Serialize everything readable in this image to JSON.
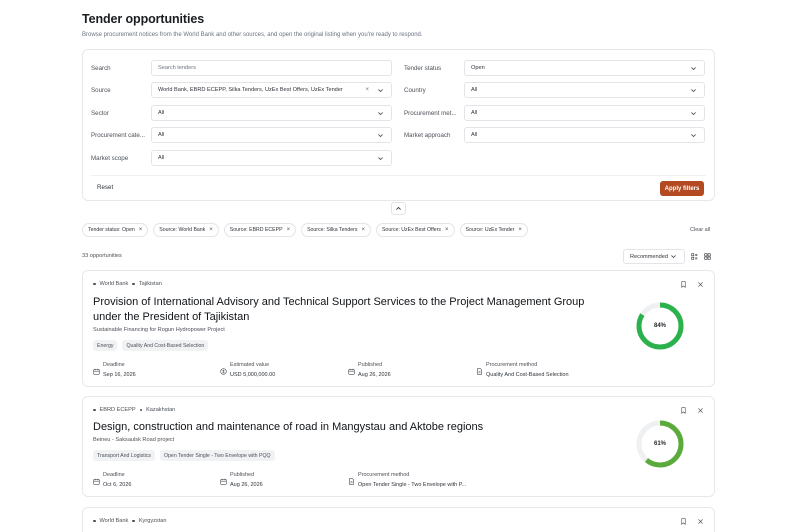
{
  "header": {
    "title": "Tender opportunities",
    "subtitle": "Browse procurement notices from the World Bank and other sources, and open the original listing when you're ready to respond."
  },
  "filters": {
    "search": {
      "label": "Search",
      "placeholder": "Search tenders"
    },
    "source": {
      "label": "Source",
      "value": "World Bank, EBRD ECEPP, Silka Tenders, UzEx Best Offers, UzEx Tender"
    },
    "sector": {
      "label": "Sector",
      "value": "All"
    },
    "procurement_category": {
      "label": "Procurement cate...",
      "value": "All"
    },
    "market_scope": {
      "label": "Market scope",
      "value": "All"
    },
    "tender_status": {
      "label": "Tender status",
      "value": "Open"
    },
    "country": {
      "label": "Country",
      "value": "All"
    },
    "procurement_method": {
      "label": "Procurement met...",
      "value": "All"
    },
    "market_approach": {
      "label": "Market approach",
      "value": "All"
    },
    "reset_label": "Reset",
    "apply_label": "Apply filters"
  },
  "chips": [
    "Tender status: Open",
    "Source: World Bank",
    "Source: EBRD ECEPP",
    "Source: Silka Tenders",
    "Source: UzEx Best Offers",
    "Source: UzEx Tender"
  ],
  "clear_all_label": "Clear all",
  "results_count": "33 opportunities",
  "sort": {
    "value": "Recommended"
  },
  "colors": {
    "accent": "#b34a22",
    "score_green": "#2bb24c",
    "score_olive": "#5aab3c",
    "track": "#eef0f2"
  },
  "cards": [
    {
      "source": "World Bank",
      "country": "Tajikistan",
      "title": "Provision of International Advisory and Technical Support Services to the Project Management Group under the President of Tajikistan",
      "subtitle": "Sustainable Financing for Rogun Hydropower Project",
      "tags": [
        "Energy",
        "Quality And Cost-Based Selection"
      ],
      "facts": [
        {
          "label": "Deadline",
          "value": "Sep 16, 2026",
          "icon": "calendar-icon"
        },
        {
          "label": "Estimated value",
          "value": "USD 5,000,000.00",
          "icon": "dollar-icon"
        },
        {
          "label": "Published",
          "value": "Aug 26, 2026",
          "icon": "calendar-icon"
        },
        {
          "label": "Procurement method",
          "value": "Quality And Cost-Based Selection",
          "icon": "document-icon"
        }
      ],
      "score": 0.84,
      "score_label": "84%"
    },
    {
      "source": "EBRD ECEPP",
      "country": "Kazakhstan",
      "title": "Design, construction and maintenance of road in Mangystau and Aktobe regions",
      "subtitle": "Beineu - Saksaulsk Road project",
      "tags": [
        "Transport And Logistics",
        "Open Tender Single - Two Envelope with PQQ"
      ],
      "facts": [
        {
          "label": "Deadline",
          "value": "Oct 6, 2026",
          "icon": "calendar-icon"
        },
        {
          "label": "Published",
          "value": "Aug 26, 2026",
          "icon": "calendar-icon"
        },
        {
          "label": "Procurement method",
          "value": "Open Tender Single - Two Envelope with P...",
          "icon": "document-icon"
        }
      ],
      "score": 0.61,
      "score_label": "61%"
    },
    {
      "source": "World Bank",
      "country": "Kyrgyzstan"
    }
  ]
}
